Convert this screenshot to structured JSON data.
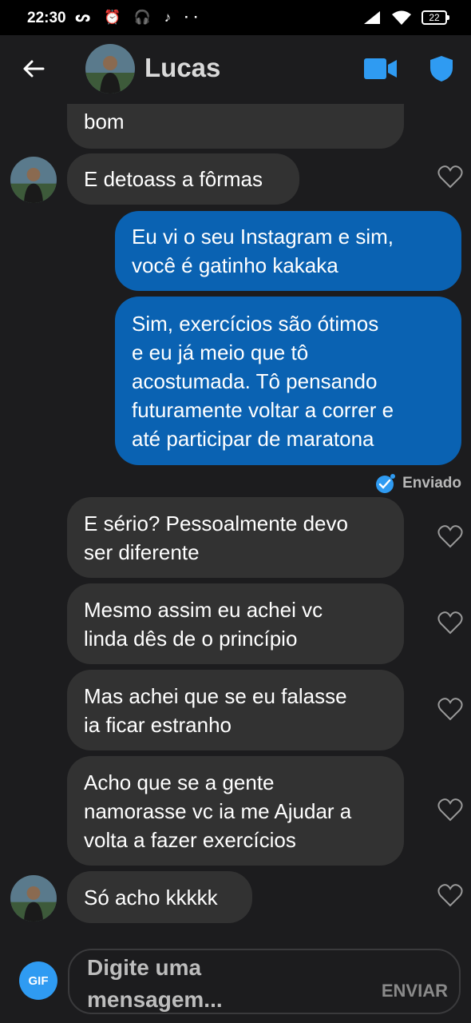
{
  "status_bar": {
    "time": "22:30",
    "left_icons": "ᔕ ⏰ 🎧 ♪  ··",
    "battery": "22"
  },
  "header": {
    "contact_name": "Lucas"
  },
  "messages": [
    {
      "direction": "in",
      "lines": [
        "bom"
      ],
      "partial_top": true
    },
    {
      "direction": "in",
      "lines": [
        "E detoass a fôrmas"
      ]
    },
    {
      "direction": "out",
      "lines": [
        "Eu vi o seu Instagram e sim,",
        "você é gatinho kakaka"
      ]
    },
    {
      "direction": "out",
      "lines": [
        "Sim, exercícios são ótimos",
        "e eu já meio que tô",
        "acostumada. Tô pensando",
        "futuramente voltar a correr e",
        "até participar de maratona"
      ]
    },
    {
      "direction": "in",
      "lines": [
        "E sério? Pessoalmente devo",
        "ser diferente"
      ]
    },
    {
      "direction": "in",
      "lines": [
        "Mesmo assim eu achei vc",
        "linda dês de o princípio"
      ]
    },
    {
      "direction": "in",
      "lines": [
        "Mas achei que se eu falasse",
        "ia ficar estranho"
      ]
    },
    {
      "direction": "in",
      "lines": [
        "Acho que se a gente",
        "namorasse vc ia me Ajudar a",
        "volta a fazer exercícios"
      ]
    },
    {
      "direction": "in",
      "lines": [
        "Só acho kkkkk"
      ]
    }
  ],
  "sent_status": "Enviado",
  "composer": {
    "gif_label": "GIF",
    "placeholder_line1": "Digite uma",
    "placeholder_line2": "mensagem...",
    "send_label": "ENVIAR"
  },
  "colors": {
    "background": "#1c1c1e",
    "incoming_bubble": "#323232",
    "outgoing_bubble": "#0a62b2",
    "accent": "#2f9bf2"
  }
}
